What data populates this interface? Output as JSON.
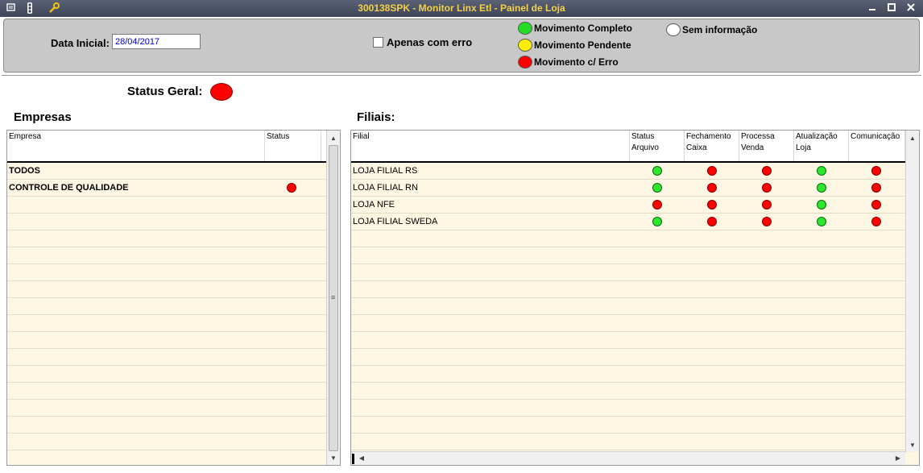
{
  "window": {
    "title": "300138SPK - Monitor Linx Etl - Painel de Loja",
    "icons": [
      "menu-icon",
      "traffic-light-icon",
      "wrench-icon"
    ],
    "controls": [
      "minimize-icon",
      "maximize-icon",
      "close-icon"
    ]
  },
  "filters": {
    "data_inicial_label": "Data Inicial:",
    "data_inicial_value": "28/04/2017",
    "apenas_com_erro_label": "Apenas com erro",
    "apenas_com_erro_checked": false
  },
  "legend": [
    {
      "label": "Movimento Completo",
      "color": "#22dd22"
    },
    {
      "label": "Movimento Pendente",
      "color": "#ffee00"
    },
    {
      "label": "Movimento c/ Erro",
      "color": "#ff0000"
    },
    {
      "label": "Sem informação",
      "color": "#ffffff"
    }
  ],
  "status_geral": {
    "label": "Status Geral:",
    "status": "red"
  },
  "empresas": {
    "title": "Empresas",
    "columns": [
      "Empresa",
      "Status"
    ],
    "rows": [
      {
        "empresa": "TODOS",
        "status": ""
      },
      {
        "empresa": "CONTROLE DE QUALIDADE",
        "status": "red"
      }
    ]
  },
  "filiais": {
    "title": "Filiais:",
    "columns": [
      {
        "line1": "Filial",
        "line2": ""
      },
      {
        "line1": "Status",
        "line2": "Arquivo"
      },
      {
        "line1": "Fechamento",
        "line2": "Caixa"
      },
      {
        "line1": "Processa",
        "line2": "Venda"
      },
      {
        "line1": "Atualização",
        "line2": "Loja"
      },
      {
        "line1": "Comunicação",
        "line2": ""
      }
    ],
    "rows": [
      {
        "filial": "LOJA FILIAL RS",
        "status": [
          "green",
          "red",
          "red",
          "green",
          "red"
        ]
      },
      {
        "filial": "LOJA FILIAL RN",
        "status": [
          "green",
          "red",
          "red",
          "green",
          "red"
        ]
      },
      {
        "filial": "LOJA NFE",
        "status": [
          "red",
          "red",
          "red",
          "green",
          "red"
        ]
      },
      {
        "filial": "LOJA FILIAL SWEDA",
        "status": [
          "green",
          "red",
          "red",
          "green",
          "red"
        ]
      }
    ]
  }
}
